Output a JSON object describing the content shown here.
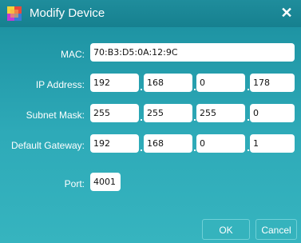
{
  "window": {
    "title": "Modify Device",
    "close_glyph": "✕",
    "icon": "app-logo-icon"
  },
  "form": {
    "mac_label": "MAC:",
    "mac_value": "70:B3:D5:0A:12:9C",
    "ip_label": "IP Address:",
    "ip": [
      "192",
      "168",
      "0",
      "178"
    ],
    "subnet_label": "Subnet Mask:",
    "subnet": [
      "255",
      "255",
      "255",
      "0"
    ],
    "gateway_label": "Default Gateway:",
    "gateway": [
      "192",
      "168",
      "0",
      "1"
    ],
    "port_label": "Port:",
    "port_value": "4001"
  },
  "buttons": {
    "ok_label": "OK",
    "cancel_label": "Cancel"
  },
  "colors": {
    "background_top": "#1a8e9e",
    "background_bottom": "#36b4bf",
    "field_bg": "#ffffff"
  }
}
